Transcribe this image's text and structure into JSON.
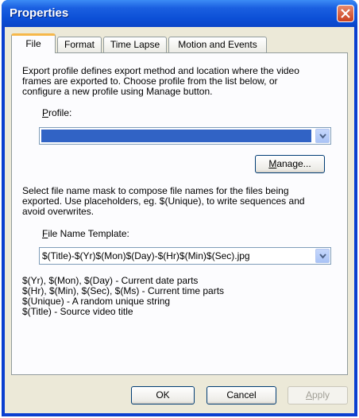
{
  "window": {
    "title": "Properties"
  },
  "tabs": [
    {
      "label": "File",
      "active": true
    },
    {
      "label": "Format"
    },
    {
      "label": "Time Lapse"
    },
    {
      "label": "Motion and Events"
    }
  ],
  "file_tab": {
    "intro_line1": "Export profile defines export method and location where the video",
    "intro_line2": "frames are exported to. Choose profile from the list below, or",
    "intro_line3": "configure a new profile using Manage button.",
    "profile_label_u": "P",
    "profile_label_rest": "rofile:",
    "profile_value": "",
    "manage_label_u": "M",
    "manage_label_rest": "anage...",
    "mask_line1": "Select file name mask to compose file names for the files being",
    "mask_line2": "exported. Use placeholders, eg. $(Unique), to write sequences and",
    "mask_line3": "avoid overwrites.",
    "template_label_u": "F",
    "template_label_rest": "ile Name Template:",
    "template_value": "$(Title)-$(Yr)$(Mon)$(Day)-$(Hr)$(Min)$(Sec).jpg",
    "help_line1": "$(Yr), $(Mon), $(Day) - Current date parts",
    "help_line2": "$(Hr), $(Min), $(Sec), $(Ms) - Current time parts",
    "help_line3": "$(Unique) - A random unique string",
    "help_line4": "$(Title) - Source video title"
  },
  "buttons": {
    "ok": "OK",
    "cancel": "Cancel",
    "apply_u": "A",
    "apply_rest": "pply"
  },
  "colors": {
    "titlebar": "#0c4fd6",
    "dialog_bg": "#ece9d8",
    "selection": "#3163c5"
  },
  "icons": [
    "close-icon",
    "chevron-down-icon"
  ]
}
